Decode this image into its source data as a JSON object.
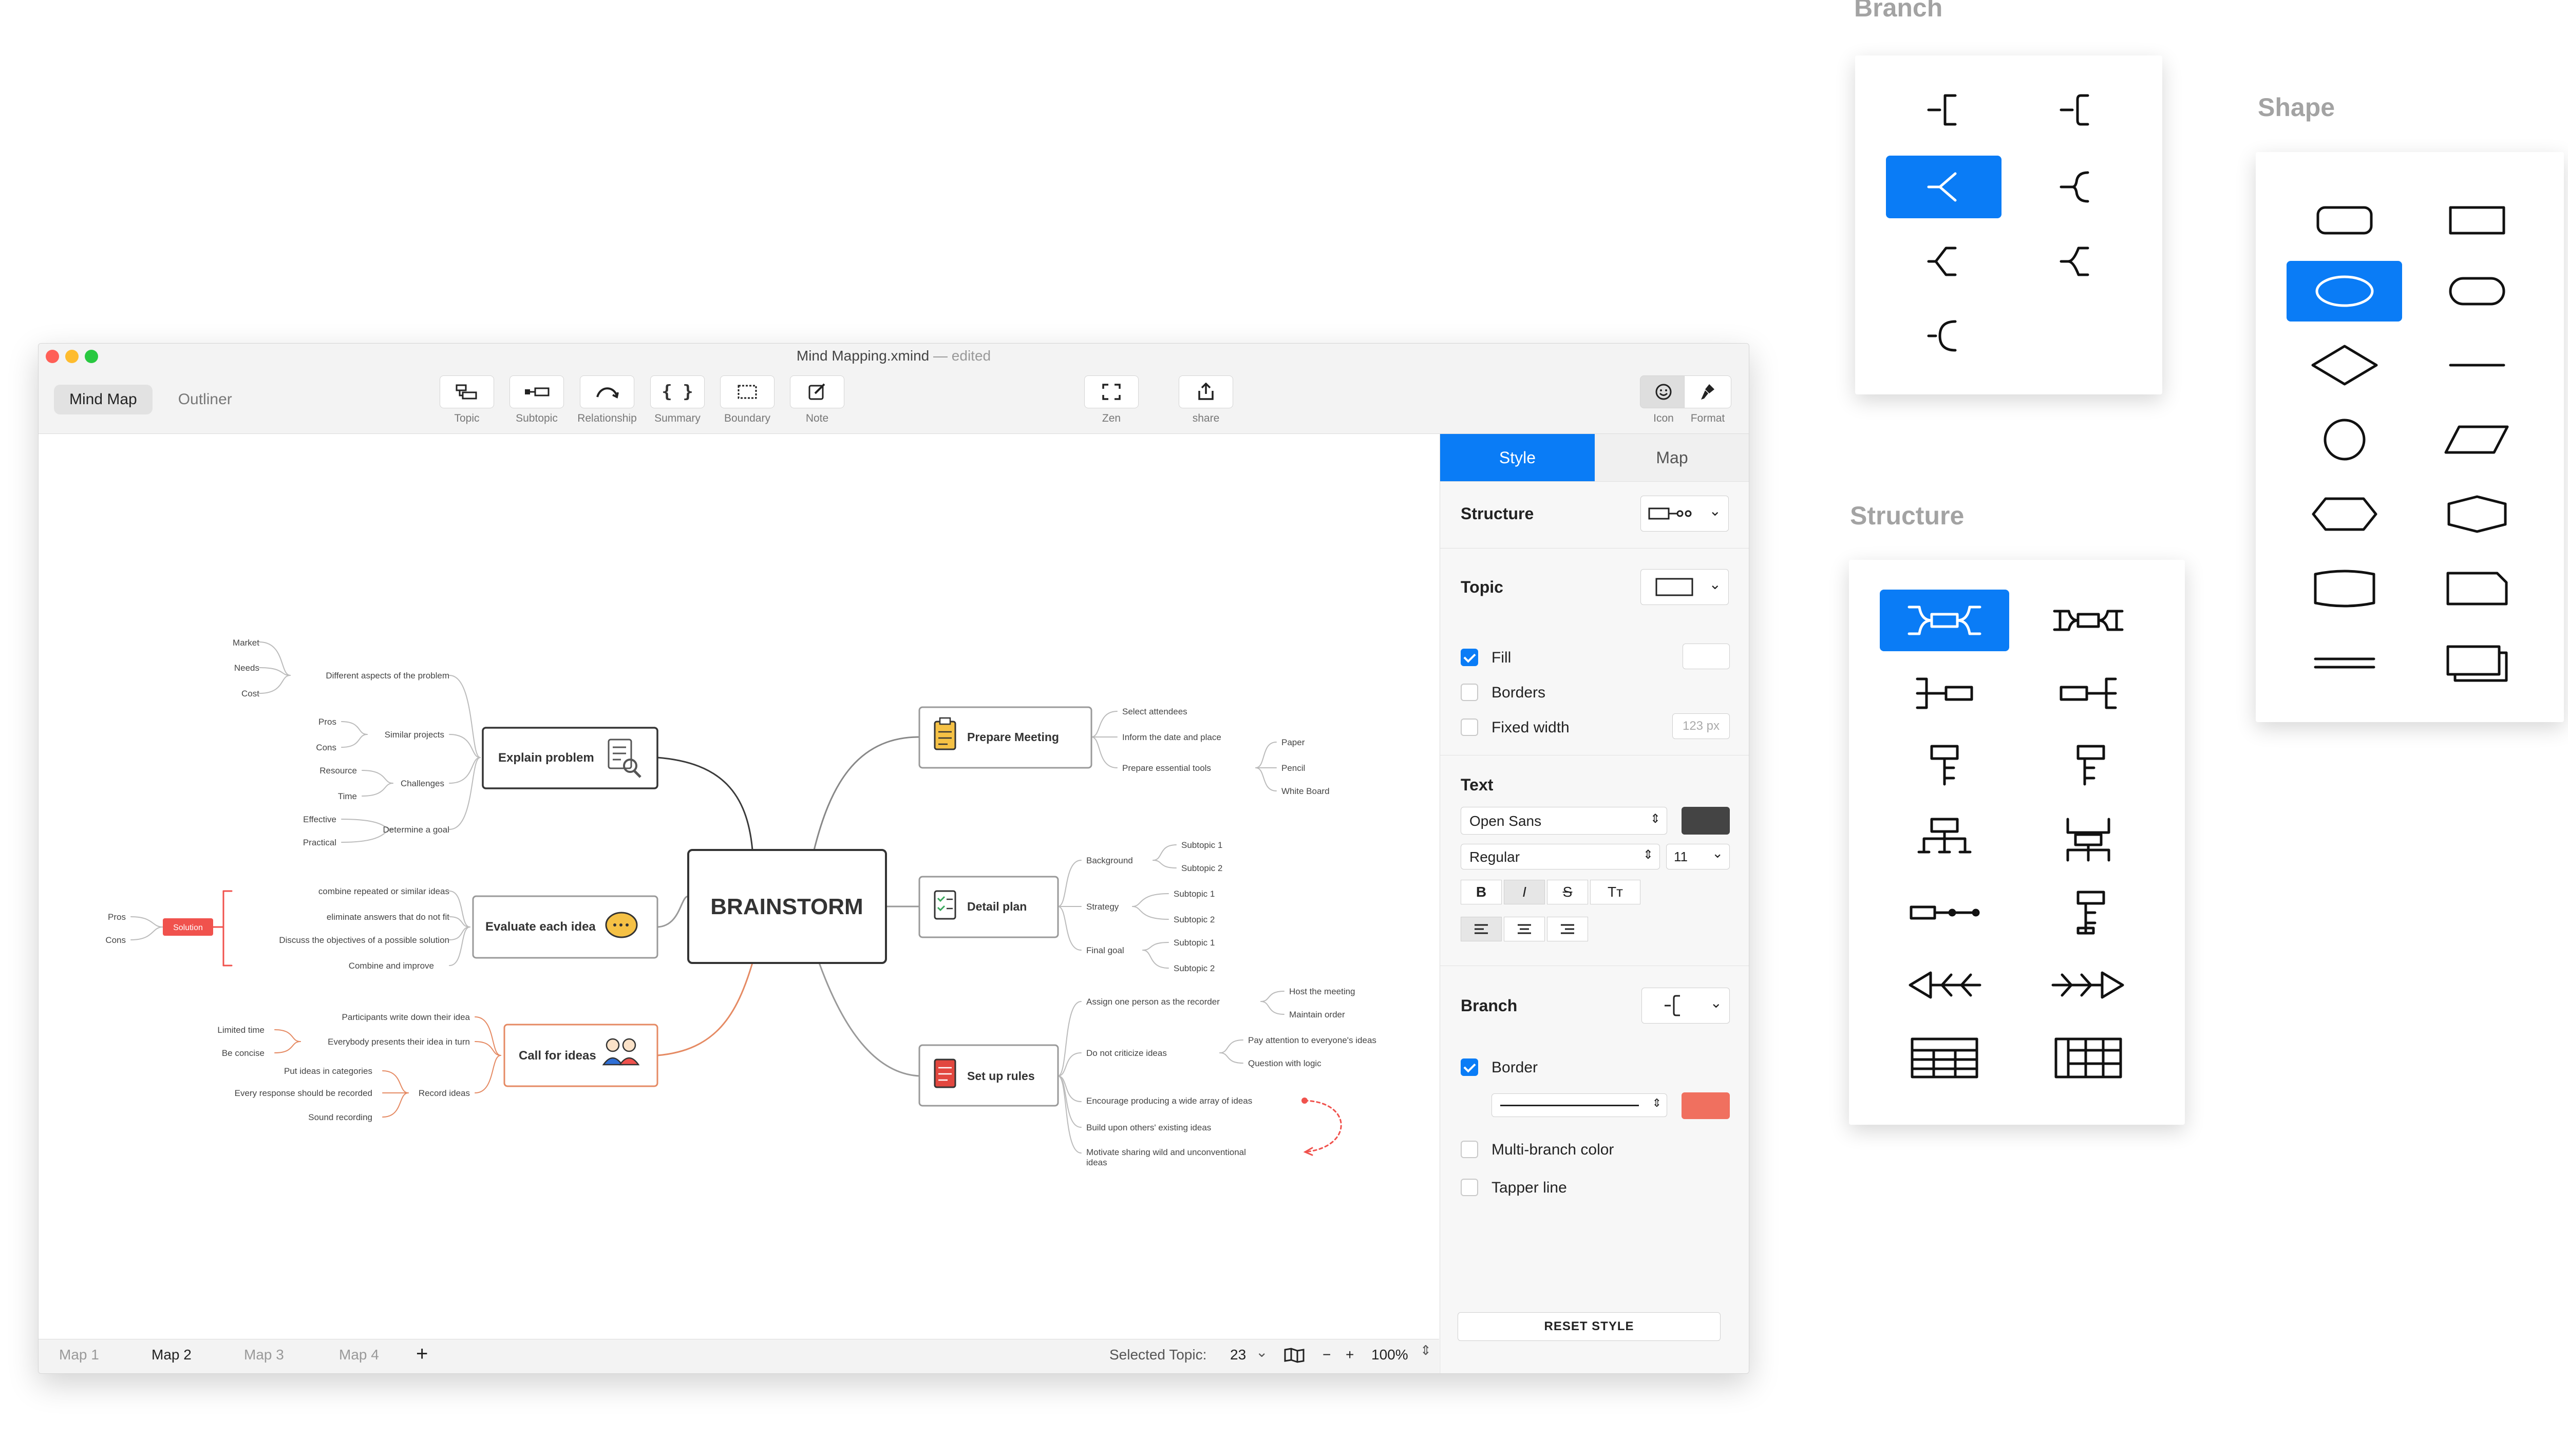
{
  "window": {
    "title": "Mind Mapping.xmind",
    "title_suffix": "— edited",
    "modes": [
      "Mind Map",
      "Outliner"
    ],
    "toolbar": [
      "Topic",
      "Subtopic",
      "Relationship",
      "Summary",
      "Boundary",
      "Note",
      "Zen",
      "share",
      "Icon",
      "Format"
    ]
  },
  "map": {
    "central": "BRAINSTORM",
    "topics": {
      "explain": "Explain problem",
      "evaluate": "Evaluate each idea",
      "call": "Call for ideas",
      "prepare": "Prepare Meeting",
      "detail": "Detail plan",
      "rules": "Set up rules"
    },
    "explain_sub": {
      "aspects": "Different aspects of the problem",
      "market": "Market",
      "needs": "Needs",
      "cost": "Cost",
      "similar": "Similar projects",
      "pros": "Pros",
      "cons": "Cons",
      "challenges": "Challenges",
      "resource": "Resource",
      "time": "Time",
      "goal": "Determine a goal",
      "effective": "Effective",
      "practical": "Practical"
    },
    "evaluate_sub": {
      "combine": "combine repeated or similar ideas",
      "eliminate": "eliminate answers that do not fit",
      "discuss": "Discuss the objectives of a possible solution",
      "improve": "Combine and improve",
      "solution": "Solution",
      "pros": "Pros",
      "cons": "Cons"
    },
    "call_sub": {
      "participants": "Participants write down their idea",
      "everybody": "Everybody presents their idea in turn",
      "limited": "Limited time",
      "concise": "Be concise",
      "record": "Record ideas",
      "categories": "Put ideas in categories",
      "every": "Every response should be recorded",
      "sound": "Sound recording"
    },
    "prepare_sub": {
      "attendees": "Select attendees",
      "date": "Inform the date and place",
      "tools": "Prepare essential tools",
      "paper": "Paper",
      "pencil": "Pencil",
      "board": "White Board"
    },
    "detail_sub": {
      "background": "Background",
      "strategy": "Strategy",
      "final": "Final goal",
      "s1": "Subtopic 1",
      "s2": "Subtopic 2"
    },
    "rules_sub": {
      "assign": "Assign one person as the recorder",
      "host": "Host the meeting",
      "maintain": "Maintain order",
      "criticize": "Do not criticize ideas",
      "attention": "Pay attention to everyone's ideas",
      "logic": "Question with logic",
      "encourage": "Encourage producing a wide array of ideas",
      "build": "Build upon others' existing ideas",
      "motivate1": "Motivate sharing wild and unconventional",
      "motivate2": "ideas"
    }
  },
  "panel": {
    "tabs": [
      "Style",
      "Map"
    ],
    "structure": "Structure",
    "topic": "Topic",
    "fill": "Fill",
    "borders": "Borders",
    "fixed_width": "Fixed width",
    "width_placeholder": "123 px",
    "text": "Text",
    "font": "Open Sans",
    "weight": "Regular",
    "size": "11",
    "bold": "B",
    "italic": "I",
    "strike": "S",
    "case": "Tт",
    "branch": "Branch",
    "border": "Border",
    "multi_branch": "Multi-branch color",
    "tapper": "Tapper line",
    "reset": "RESET STYLE",
    "text_color": "#444444",
    "border_color": "#f0705f"
  },
  "statusbar": {
    "maps": [
      "Map 1",
      "Map 2",
      "Map 3",
      "Map 4"
    ],
    "add": "+",
    "selected_label": "Selected Topic:",
    "selected_count": "23",
    "minus": "−",
    "plus": "+",
    "zoom": "100%"
  },
  "palettes": {
    "branch": "Branch",
    "shape": "Shape",
    "structure": "Structure"
  },
  "colors": {
    "accent": "#0a7cf6",
    "solution": "#f0524d",
    "orange_branch": "#e58a63"
  }
}
